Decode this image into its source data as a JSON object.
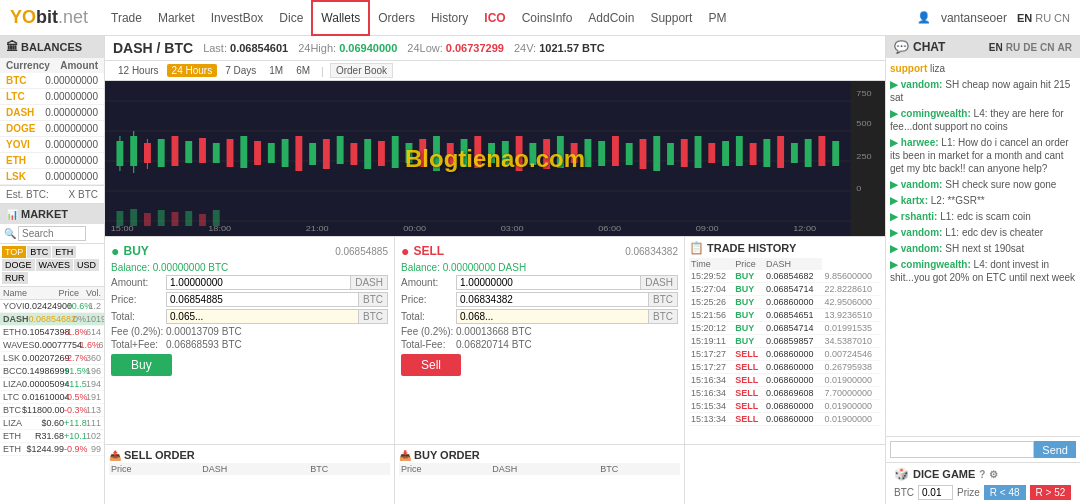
{
  "header": {
    "logo": "YO",
    "logo_suffix": "bit",
    "logo_net": ".net",
    "nav": [
      "Trade",
      "Market",
      "InvestBox",
      "Dice",
      "Wallets",
      "Orders",
      "History",
      "ICO",
      "CoinsInfo",
      "AddCoin",
      "Support",
      "PM"
    ],
    "active_nav": "Wallets",
    "user": "vantanseoer",
    "langs": [
      "EN",
      "RU",
      "CN"
    ]
  },
  "balances": {
    "title": "BALANCES",
    "columns": [
      "Currency",
      "Amount"
    ],
    "rows": [
      {
        "currency": "BTC",
        "amount": "0.00000000"
      },
      {
        "currency": "LTC",
        "amount": "0.00000000"
      },
      {
        "currency": "DASH",
        "amount": "0.00000000"
      },
      {
        "currency": "DOGE",
        "amount": "0.00000000"
      },
      {
        "currency": "YOVI",
        "amount": "0.00000000"
      },
      {
        "currency": "ETH",
        "amount": "0.00000000"
      },
      {
        "currency": "LSK",
        "amount": "0.00000000"
      }
    ],
    "est_btc_label": "Est. BTC:",
    "est_btc_value": "X BTC"
  },
  "market": {
    "title": "MARKET",
    "search_placeholder": "Search",
    "tabs": [
      "TOP",
      "BTC",
      "ETH",
      "DOGE",
      "WAVES",
      "USD",
      "RUR"
    ],
    "active_tab": "TOP",
    "columns": [
      "Name",
      "Price",
      "Vol."
    ],
    "rows": [
      {
        "name": "YOVI",
        "price": "0.02424900",
        "change": "+0.6%",
        "vol": "1.2",
        "positive": true
      },
      {
        "name": "DASH",
        "price": "0.06854682",
        "change": "0%",
        "vol": "1019.4",
        "positive": false,
        "selected": true
      },
      {
        "name": "ETH",
        "price": "0.10547398",
        "change": "-1.8%",
        "vol": "614.4",
        "positive": false
      },
      {
        "name": "WAVES",
        "price": "0.00077754",
        "change": "-1.6%",
        "vol": "614.4",
        "positive": false
      },
      {
        "name": "LSK",
        "price": "0.00207269",
        "change": "-2.7%",
        "vol": "359.6",
        "positive": false
      },
      {
        "name": "BCC",
        "price": "0.14986999",
        "change": "+1.5%",
        "vol": "195.5",
        "positive": true
      },
      {
        "name": "LIZA",
        "price": "0.00005094",
        "change": "+11.5%",
        "vol": "194",
        "positive": true
      },
      {
        "name": "LTC",
        "price": "0.01610004",
        "change": "-0.5%",
        "vol": "191.4",
        "positive": false
      },
      {
        "name": "BTC",
        "price": "$11800.00",
        "change": "-0.3%",
        "vol": "112.9",
        "positive": false
      },
      {
        "name": "LIZA",
        "price": "$0.60",
        "change": "+11.8%",
        "vol": "110.5",
        "positive": true
      },
      {
        "name": "ETH",
        "price": "R31.68",
        "change": "+10.1%",
        "vol": "102.1",
        "positive": true
      },
      {
        "name": "ETH",
        "price": "$1244.99",
        "change": "-0.9%",
        "vol": "99.4",
        "positive": false
      }
    ]
  },
  "chart": {
    "pair": "DASH / BTC",
    "last_label": "Last:",
    "last_value": "0.06854601",
    "high_label": "24High:",
    "high_value": "0.06940000",
    "low_label": "24Low:",
    "low_value": "0.06737299",
    "vol_label": "24V:",
    "vol_value": "1021.57 BTC",
    "timeframes": [
      "12 Hours",
      "24 Hours",
      "7 Days",
      "1M",
      "6M"
    ],
    "active_tf": "24 Hours",
    "order_book": "Order Book"
  },
  "buy": {
    "title": "BUY",
    "price_display": "0.06854885",
    "balance_label": "Balance:",
    "balance_value": "0.00000000 BTC",
    "amount_label": "Amount:",
    "amount_value": "1.00000000",
    "amount_currency": "DASH",
    "price_label": "Price:",
    "price_value": "0.06854885",
    "price_currency": "BTC",
    "total_label": "Total:",
    "total_value": "0.065...",
    "fee_label": "Fee (0.2%):",
    "fee_value": "0.00013709",
    "fee_currency": "BTC",
    "total_fee_label": "Total+Fee:",
    "total_fee_value": "0.06868593",
    "total_fee_currency": "BTC",
    "button": "Buy"
  },
  "sell": {
    "title": "SELL",
    "price_display": "0.06834382",
    "balance_label": "Balance:",
    "balance_value": "0.00000000 DASH",
    "amount_label": "Amount:",
    "amount_value": "1.00000000",
    "amount_currency": "DASH",
    "price_label": "Price:",
    "price_value": "0.06834382",
    "price_currency": "BTC",
    "total_label": "Total:",
    "total_value": "0.068...",
    "fee_label": "Fee (0.2%):",
    "fee_value": "0.00013668",
    "fee_currency": "BTC",
    "total_fee_label": "Total-Fee:",
    "total_fee_value": "0.06820714",
    "total_fee_currency": "BTC",
    "button": "Sell"
  },
  "sell_order": {
    "title": "SELL ORDER",
    "columns": [
      "Price",
      "DASH",
      "BTC"
    ]
  },
  "buy_order": {
    "title": "BUY ORDER",
    "columns": [
      "Price",
      "DASH",
      "BTC"
    ]
  },
  "trade_history": {
    "title": "TRADE HISTORY",
    "columns": [
      "Time",
      "Price",
      "DASH"
    ],
    "rows": [
      {
        "time": "15:29:52",
        "type": "BUY",
        "price": "0.06854682",
        "amount": "9.85600000"
      },
      {
        "time": "15:27:04",
        "type": "BUY",
        "price": "0.06854714",
        "amount": "22.8228610"
      },
      {
        "time": "15:25:26",
        "type": "BUY",
        "price": "0.06860000",
        "amount": "42.9506000"
      },
      {
        "time": "15:21:56",
        "type": "BUY",
        "price": "0.06854651",
        "amount": "13.9236510"
      },
      {
        "time": "15:20:12",
        "type": "BUY",
        "price": "0.06854714",
        "amount": "0.01991535"
      },
      {
        "time": "15:19:11",
        "type": "BUY",
        "price": "0.06859857",
        "amount": "34.5387010"
      },
      {
        "time": "15:17:27",
        "type": "SELL",
        "price": "0.06860000",
        "amount": "0.00724546"
      },
      {
        "time": "15:17:27",
        "type": "SELL",
        "price": "0.06860000",
        "amount": "0.26795938"
      },
      {
        "time": "15:16:34",
        "type": "SELL",
        "price": "0.06860000",
        "amount": "0.01900000"
      },
      {
        "time": "15:16:34",
        "type": "SELL",
        "price": "0.06869608",
        "amount": "7.70000000"
      },
      {
        "time": "15:15:34",
        "type": "SELL",
        "price": "0.06860000",
        "amount": "0.01900000"
      },
      {
        "time": "15:13:34",
        "type": "SELL",
        "price": "0.06860000",
        "amount": "0.01900000"
      }
    ]
  },
  "chat": {
    "title": "CHAT",
    "langs": [
      "EN",
      "RU",
      "DE",
      "CN",
      "AR"
    ],
    "active_lang": "EN",
    "messages": [
      {
        "user": "support",
        "text": "liza"
      },
      {
        "user": "vandom",
        "text": "SH cheap now again hit 215 sat"
      },
      {
        "user": "comingwealth",
        "text": "L4: they are here for fee...dont support no coins"
      },
      {
        "user": "harwee",
        "text": "L1: How do i cancel an order its been in market for a month and cant get my btc back!! can anyone help?"
      },
      {
        "user": "vandom",
        "text": "SH check sure now gone"
      },
      {
        "user": "kartx",
        "text": "L2: **GSR**"
      },
      {
        "user": "rshanti",
        "text": "L1: edc is scam coin"
      },
      {
        "user": "vandom",
        "text": "L1: edc dev is cheater"
      },
      {
        "user": "vandom",
        "text": "SH next st 190sat"
      },
      {
        "user": "comingwealth",
        "text": "L4: dont invest in shit...you got 20% on ETC until next week"
      }
    ],
    "input_placeholder": "",
    "send_button": "Send"
  },
  "dice": {
    "title": "DICE GAME",
    "btc_label": "BTC",
    "btc_value": "0.01",
    "prize_label": "Prize",
    "r48_button": "R < 48",
    "r52_button": "R > 52"
  },
  "blogtienao": "Blogtienao.com"
}
